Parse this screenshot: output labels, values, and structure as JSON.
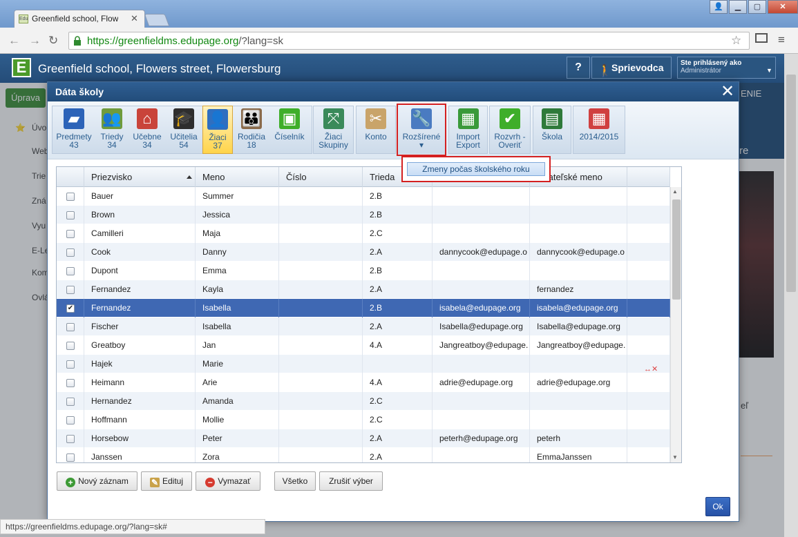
{
  "browser": {
    "tab_title": "Greenfield school, Flowers",
    "tab_favicon": "Edu",
    "url_host": "https://greenfieldms.edupage.org",
    "url_path": "/?lang=sk",
    "status_url": "https://greenfieldms.edupage.org/?lang=sk#"
  },
  "site": {
    "title": "Greenfield school, Flowers street, Flowersburg",
    "help_label": "?",
    "guide_label": "Sprievodca",
    "logged_in_label": "Ste prihlásený ako",
    "logged_in_user": "Administrátor"
  },
  "background": {
    "edit_label": "Úprava",
    "sidebar": [
      "Úvo",
      "Web",
      "Trie",
      "Zná",
      "Vyu",
      "E-Le",
      "Kom",
      "Ovlá"
    ],
    "right_top": "ENIE",
    "right_menu": "re",
    "right_text": "eľ"
  },
  "dialog": {
    "title": "Dáta školy",
    "toolbar": [
      {
        "label": "Predmety",
        "count": "43",
        "icon": "book-icon",
        "color": "#2c63b8"
      },
      {
        "label": "Triedy",
        "count": "34",
        "icon": "people-icon",
        "color": "#6f9b3c"
      },
      {
        "label": "Učebne",
        "count": "34",
        "icon": "house-icon",
        "color": "#c9443a"
      },
      {
        "label": "Učitelia",
        "count": "54",
        "icon": "teacher-icon",
        "color": "#2e2e2e"
      },
      {
        "label": "Žiaci",
        "count": "37",
        "icon": "student-icon",
        "color": "#2f6fc0"
      },
      {
        "label": "Rodičia",
        "count": "18",
        "icon": "parents-icon",
        "color": "#8a6a4a"
      },
      {
        "label": "Číselník",
        "count": "",
        "icon": "cubes-icon",
        "color": "#3fae2a"
      },
      {
        "label": "Žiaci",
        "count": "Skupiny",
        "icon": "groups-icon",
        "color": "#3a8a5a"
      },
      {
        "label": "Konto",
        "count": "",
        "icon": "tools-icon",
        "color": "#c9a46a"
      },
      {
        "label": "Rozšírené",
        "count": "▾",
        "icon": "wrench-icon",
        "color": "#4a7bc1"
      },
      {
        "label": "Import",
        "count": "Export",
        "icon": "spreadsheet-icon",
        "color": "#3a9a3a"
      },
      {
        "label": "Rozvrh -",
        "count": "Overiť",
        "icon": "check-icon",
        "color": "#3fae2a"
      },
      {
        "label": "Škola",
        "count": "",
        "icon": "board-icon",
        "color": "#2f7a3a"
      },
      {
        "label": "2014/2015",
        "count": "",
        "icon": "calendar-icon",
        "color": "#d04040"
      }
    ],
    "dropdown_item": "Zmeny počas školského roku",
    "columns": [
      "Priezvisko",
      "Meno",
      "Číslo",
      "Trieda",
      "",
      "žívateľské meno"
    ],
    "rows": [
      {
        "checked": false,
        "surname": "Bauer",
        "name": "Summer",
        "number": "",
        "class": "2.B",
        "email": "",
        "username": "",
        "flag": ""
      },
      {
        "checked": false,
        "surname": "Brown",
        "name": "Jessica",
        "number": "",
        "class": "2.B",
        "email": "",
        "username": "",
        "flag": ""
      },
      {
        "checked": false,
        "surname": "Camilleri",
        "name": "Maja",
        "number": "",
        "class": "2.C",
        "email": "",
        "username": "",
        "flag": ""
      },
      {
        "checked": false,
        "surname": "Cook",
        "name": "Danny",
        "number": "",
        "class": "2.A",
        "email": "dannycook@edupage.o",
        "username": "dannycook@edupage.o",
        "flag": ""
      },
      {
        "checked": false,
        "surname": "Dupont",
        "name": "Emma",
        "number": "",
        "class": "2.B",
        "email": "",
        "username": "",
        "flag": ""
      },
      {
        "checked": false,
        "surname": "Fernandez",
        "name": "Kayla",
        "number": "",
        "class": "2.A",
        "email": "",
        "username": "fernandez",
        "flag": ""
      },
      {
        "checked": true,
        "surname": "Fernandez",
        "name": "Isabella",
        "number": "",
        "class": "2.B",
        "email": "isabela@edupage.org",
        "username": "isabela@edupage.org",
        "flag": ""
      },
      {
        "checked": false,
        "surname": "Fischer",
        "name": "Isabella",
        "number": "",
        "class": "2.A",
        "email": "Isabella@edupage.org",
        "username": "Isabella@edupage.org",
        "flag": ""
      },
      {
        "checked": false,
        "surname": "Greatboy",
        "name": "Jan",
        "number": "",
        "class": "4.A",
        "email": "Jangreatboy@edupage.",
        "username": "Jangreatboy@edupage.",
        "flag": ""
      },
      {
        "checked": false,
        "surname": "Hajek",
        "name": "Marie",
        "number": "",
        "class": "",
        "email": "",
        "username": "",
        "flag": "↔✕"
      },
      {
        "checked": false,
        "surname": "Heimann",
        "name": "Arie",
        "number": "",
        "class": "4.A",
        "email": "adrie@edupage.org",
        "username": "adrie@edupage.org",
        "flag": ""
      },
      {
        "checked": false,
        "surname": "Hernandez",
        "name": "Amanda",
        "number": "",
        "class": "2.C",
        "email": "",
        "username": "",
        "flag": ""
      },
      {
        "checked": false,
        "surname": "Hoffmann",
        "name": "Mollie",
        "number": "",
        "class": "2.C",
        "email": "",
        "username": "",
        "flag": ""
      },
      {
        "checked": false,
        "surname": "Horsebow",
        "name": "Peter",
        "number": "",
        "class": "2.A",
        "email": "peterh@edupage.org",
        "username": "peterh",
        "flag": ""
      },
      {
        "checked": false,
        "surname": "Janssen",
        "name": "Zora",
        "number": "",
        "class": "2.A",
        "email": "",
        "username": "EmmaJanssen",
        "flag": ""
      }
    ],
    "buttons": {
      "new_record": "Nový záznam",
      "edit": "Edituj",
      "delete": "Vymazať",
      "all": "Všetko",
      "deselect": "Zrušiť výber",
      "ok": "Ok"
    }
  }
}
